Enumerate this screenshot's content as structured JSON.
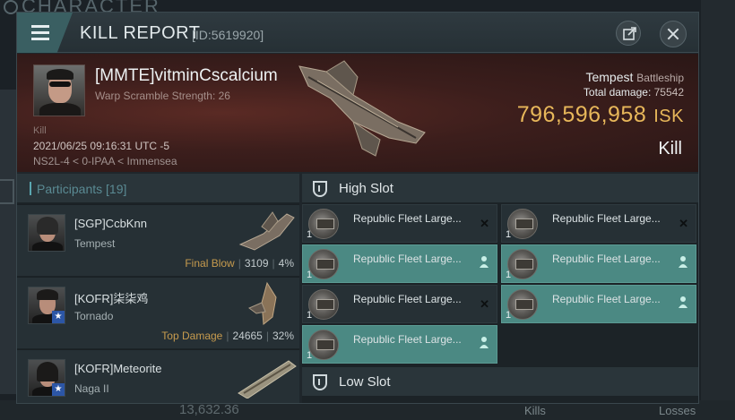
{
  "background": {
    "title": "CHARACTER",
    "bottom_value": "13,632.36",
    "bottom_label_1": "Kills",
    "bottom_label_2": "Losses"
  },
  "header": {
    "title": "KILL REPORT",
    "report_id": "[ID:5619920]"
  },
  "victim": {
    "name": "[MMTE]vitminCscalcium",
    "warp_scramble": "Warp Scramble Strength: 26",
    "kill_small": "Kill",
    "time": "2021/06/25 09:16:31 UTC -5",
    "location": "NS2L-4 < 0-IPAA < Immensea",
    "ship_name": "Tempest",
    "ship_class": "Battleship",
    "total_damage_label": "Total damage:",
    "total_damage": "75542",
    "isk_value": "796,596,958",
    "isk_unit": "ISK",
    "result": "Kill"
  },
  "participants": {
    "title": "Participants [19]",
    "items": [
      {
        "name": "[SGP]CcbKnn",
        "ship": "Tempest",
        "tag": "Final Blow",
        "damage": "3109",
        "percent": "4%",
        "badge": false
      },
      {
        "name": "[KOFR]柒柒鸡",
        "ship": "Tornado",
        "tag": "Top Damage",
        "damage": "24665",
        "percent": "32%",
        "badge": true
      },
      {
        "name": "[KOFR]Meteorite",
        "ship": "Naga II",
        "tag": "",
        "damage": "",
        "percent": "",
        "badge": true
      }
    ]
  },
  "slots": {
    "high_slot_label": "High Slot",
    "low_slot_label": "Low Slot",
    "high_modules": [
      {
        "name": "Republic Fleet Large...",
        "qty": "1",
        "status": "destroyed"
      },
      {
        "name": "Republic Fleet Large...",
        "qty": "1",
        "status": "destroyed"
      },
      {
        "name": "Republic Fleet Large...",
        "qty": "1",
        "status": "dropped"
      },
      {
        "name": "Republic Fleet Large...",
        "qty": "1",
        "status": "dropped"
      },
      {
        "name": "Republic Fleet Large...",
        "qty": "1",
        "status": "destroyed"
      },
      {
        "name": "Republic Fleet Large...",
        "qty": "1",
        "status": "dropped"
      },
      {
        "name": "Republic Fleet Large...",
        "qty": "1",
        "status": "dropped"
      }
    ]
  },
  "colors": {
    "accent_teal": "#4b8983",
    "isk_gold": "#e7b75a",
    "banner_red": "#5a2a24"
  }
}
